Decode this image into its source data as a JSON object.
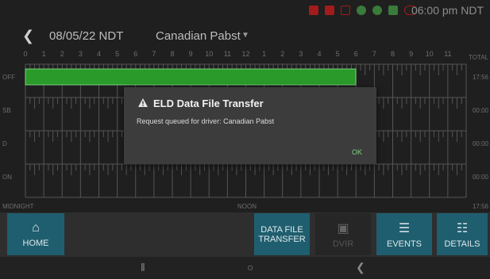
{
  "status_bar": {
    "time": "06:00 pm NDT"
  },
  "header": {
    "date": "08/05/22 NDT",
    "driver": "Canadian Pabst"
  },
  "grid": {
    "hour_labels": [
      "0",
      "1",
      "2",
      "3",
      "4",
      "5",
      "6",
      "7",
      "8",
      "9",
      "10",
      "11",
      "12",
      "1",
      "2",
      "3",
      "4",
      "5",
      "6",
      "7",
      "8",
      "9",
      "10",
      "11"
    ],
    "total_header": "TOTAL",
    "rows": [
      {
        "label": "OFF",
        "total": "17:56"
      },
      {
        "label": "SB",
        "total": "00:00"
      },
      {
        "label": "D",
        "total": "00:00"
      },
      {
        "label": "ON",
        "total": "00:00"
      }
    ],
    "midnight_label": "MIDNIGHT",
    "noon_label": "NOON",
    "grand_total": "17:56"
  },
  "toolbar": {
    "home": "HOME",
    "data_file_transfer_line1": "DATA FILE",
    "data_file_transfer_line2": "TRANSFER",
    "dvir": "DVIR",
    "events": "EVENTS",
    "details": "DETAILS"
  },
  "dialog": {
    "title": "ELD Data File Transfer",
    "message": "Request queued for driver: Canadian Pabst",
    "ok": "OK"
  },
  "colors": {
    "off_duty_bar": "#2a9a2a",
    "accent_teal": "#1f5e6e",
    "ok_text": "#7bd17e"
  }
}
